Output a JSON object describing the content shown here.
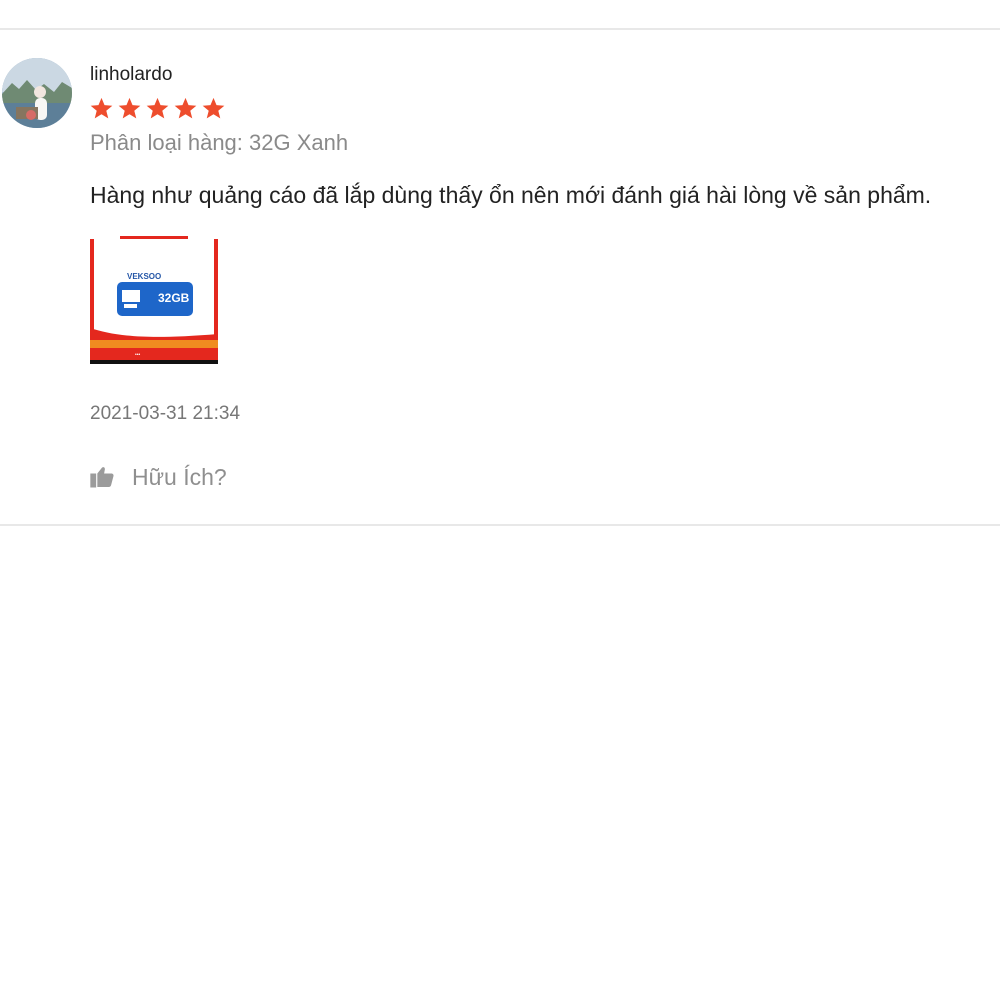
{
  "review": {
    "username": "linholardo",
    "rating": 5,
    "rating_max": 5,
    "variation": "Phân loại hàng: 32G Xanh",
    "comment": "Hàng như quảng cáo đã lắp dùng thấy ổn nên mới đánh giá hài lòng về sản phẩm.",
    "timestamp": "2021-03-31 21:34",
    "helpful_label": "Hữu Ích?",
    "star_color": "#ee4d2d",
    "helpful_icon": "thumbs-up-icon",
    "avatar_icon": "avatar",
    "image": {
      "brand_text": "VEKSOO",
      "capacity_text": "32GB",
      "accent_red": "#e4281e",
      "card_blue": "#1e66c9"
    }
  }
}
